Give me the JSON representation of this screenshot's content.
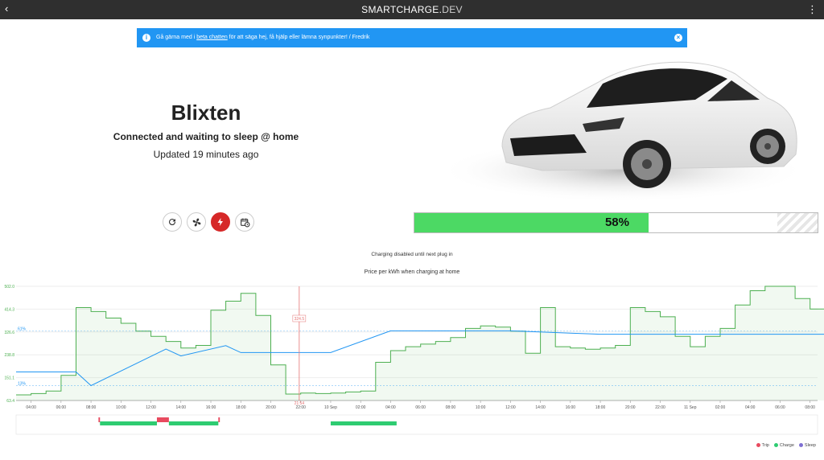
{
  "topbar": {
    "title_main": "SMARTCHARGE.",
    "title_suffix": "DEV",
    "back_glyph": "‹",
    "menu_glyph": "⋮"
  },
  "banner": {
    "text_before": "Gå gärna med i ",
    "link": "beta chatten",
    "text_after": " för att säga hej, få hjälp eller lämna synpunkter! / Fredrik",
    "icon": "info-icon",
    "close_icon": "close-icon"
  },
  "vehicle": {
    "name": "Blixten",
    "status": "Connected and waiting to sleep @ home",
    "updated": "Updated 19 minutes ago",
    "battery_level": 58,
    "battery_label": "58%"
  },
  "actions": [
    {
      "name": "refresh-button",
      "icon": "refresh-icon"
    },
    {
      "name": "climate-button",
      "icon": "fan-icon"
    },
    {
      "name": "charge-button",
      "icon": "lightning-icon",
      "active": true
    },
    {
      "name": "schedule-button",
      "icon": "calendar-clock-icon"
    }
  ],
  "charging_note": "Charging disabled until next plug in",
  "chart_title": "Price per kWh when charging at home",
  "colors": {
    "price": "#4caf50",
    "level": "#2196f3",
    "now": "#e57373",
    "trip": "#e84a5f",
    "charge": "#2ecc71",
    "sleep": "#7e6fd3",
    "battery": "#4cd964"
  },
  "chart_data": {
    "type": "line",
    "title": "Price per kWh when charging at home",
    "y_ticks": [
      "502.0",
      "414.3",
      "326.6",
      "238.8",
      "151.1",
      "63.4"
    ],
    "ylim": [
      63.4,
      502.0
    ],
    "level_labels": [
      "61%",
      "13%"
    ],
    "level_ylim": [
      0,
      100
    ],
    "x_ticks": [
      "04:00",
      "06:00",
      "08:00",
      "10:00",
      "12:00",
      "14:00",
      "16:00",
      "18:00",
      "20:00",
      "22:00",
      "10 Sep",
      "02:00",
      "04:00",
      "06:00",
      "08:00",
      "10:00",
      "12:00",
      "14:00",
      "16:00",
      "18:00",
      "20:00",
      "22:00",
      "11 Sep",
      "02:00",
      "04:00",
      "06:00",
      "08:00",
      "10:00",
      "12:00",
      "14:00",
      "16:00",
      "18:00",
      "20:00",
      "22:00"
    ],
    "x_range_hours": [
      3,
      50
    ],
    "now": {
      "hour": 21.9,
      "time_label": "21:54",
      "price_label": "324.5"
    },
    "series": [
      {
        "name": "",
        "kind": "price",
        "points": [
          [
            3,
            85
          ],
          [
            4,
            85
          ],
          [
            4,
            90
          ],
          [
            5,
            90
          ],
          [
            5,
            100
          ],
          [
            6,
            100
          ],
          [
            6,
            160
          ],
          [
            7,
            160
          ],
          [
            7,
            420
          ],
          [
            8,
            420
          ],
          [
            8,
            405
          ],
          [
            9,
            405
          ],
          [
            9,
            380
          ],
          [
            10,
            380
          ],
          [
            10,
            360
          ],
          [
            11,
            360
          ],
          [
            11,
            330
          ],
          [
            12,
            330
          ],
          [
            12,
            310
          ],
          [
            13,
            310
          ],
          [
            13,
            290
          ],
          [
            14,
            290
          ],
          [
            14,
            265
          ],
          [
            15,
            265
          ],
          [
            15,
            275
          ],
          [
            16,
            275
          ],
          [
            16,
            410
          ],
          [
            17,
            410
          ],
          [
            17,
            445
          ],
          [
            18,
            445
          ],
          [
            18,
            475
          ],
          [
            19,
            475
          ],
          [
            19,
            390
          ],
          [
            20,
            390
          ],
          [
            20,
            200
          ],
          [
            21,
            200
          ],
          [
            21,
            88
          ],
          [
            22,
            88
          ],
          [
            22,
            92
          ],
          [
            23,
            92
          ],
          [
            23,
            90
          ],
          [
            24,
            90
          ],
          [
            24,
            92
          ],
          [
            25,
            92
          ],
          [
            25,
            96
          ],
          [
            26,
            96
          ],
          [
            26,
            100
          ],
          [
            27,
            100
          ],
          [
            27,
            210
          ],
          [
            28,
            210
          ],
          [
            28,
            255
          ],
          [
            29,
            255
          ],
          [
            29,
            270
          ],
          [
            30,
            270
          ],
          [
            30,
            280
          ],
          [
            31,
            280
          ],
          [
            31,
            290
          ],
          [
            32,
            290
          ],
          [
            32,
            305
          ],
          [
            33,
            305
          ],
          [
            33,
            340
          ],
          [
            34,
            340
          ],
          [
            34,
            350
          ],
          [
            35,
            350
          ],
          [
            35,
            345
          ],
          [
            36,
            345
          ],
          [
            36,
            330
          ],
          [
            37,
            330
          ],
          [
            37,
            245
          ],
          [
            38,
            245
          ],
          [
            38,
            420
          ],
          [
            39,
            420
          ],
          [
            39,
            270
          ],
          [
            40,
            270
          ],
          [
            40,
            265
          ],
          [
            41,
            265
          ],
          [
            41,
            260
          ],
          [
            42,
            260
          ],
          [
            42,
            265
          ],
          [
            43,
            265
          ],
          [
            43,
            275
          ],
          [
            44,
            275
          ],
          [
            44,
            420
          ],
          [
            45,
            420
          ],
          [
            45,
            405
          ],
          [
            46,
            405
          ],
          [
            46,
            385
          ],
          [
            47,
            385
          ],
          [
            47,
            310
          ],
          [
            48,
            310
          ],
          [
            48,
            270
          ],
          [
            49,
            270
          ],
          [
            49,
            310
          ],
          [
            50,
            310
          ],
          [
            50,
            340
          ],
          [
            51,
            340
          ],
          [
            51,
            430
          ],
          [
            52,
            430
          ],
          [
            52,
            485
          ],
          [
            53,
            485
          ],
          [
            53,
            502
          ],
          [
            55,
            502
          ],
          [
            55,
            455
          ],
          [
            56,
            455
          ],
          [
            56,
            415
          ],
          [
            57,
            415
          ]
        ]
      },
      {
        "name": "",
        "kind": "level",
        "points": [
          [
            3,
            25
          ],
          [
            7,
            25
          ],
          [
            8,
            13
          ],
          [
            13,
            45
          ],
          [
            14,
            39
          ],
          [
            17,
            48
          ],
          [
            18,
            42
          ],
          [
            24,
            42
          ],
          [
            28,
            61
          ],
          [
            36,
            61
          ],
          [
            40,
            59
          ],
          [
            42,
            58
          ],
          [
            57,
            58
          ]
        ]
      }
    ],
    "events": [
      {
        "type": "trip",
        "start": 8.5,
        "end": 8.6
      },
      {
        "type": "charge",
        "start": 8.6,
        "end": 12.4
      },
      {
        "type": "trip",
        "start": 12.4,
        "end": 13.2
      },
      {
        "type": "charge",
        "start": 13.2,
        "end": 16.5
      },
      {
        "type": "trip",
        "start": 16.5,
        "end": 16.6
      },
      {
        "type": "charge",
        "start": 24.0,
        "end": 28.4
      }
    ],
    "legend": [
      {
        "label": "Trip",
        "color_key": "trip"
      },
      {
        "label": "Charge",
        "color_key": "charge"
      },
      {
        "label": "Sleep",
        "color_key": "sleep"
      }
    ],
    "legend_position": "bottom-right",
    "grid": true
  }
}
